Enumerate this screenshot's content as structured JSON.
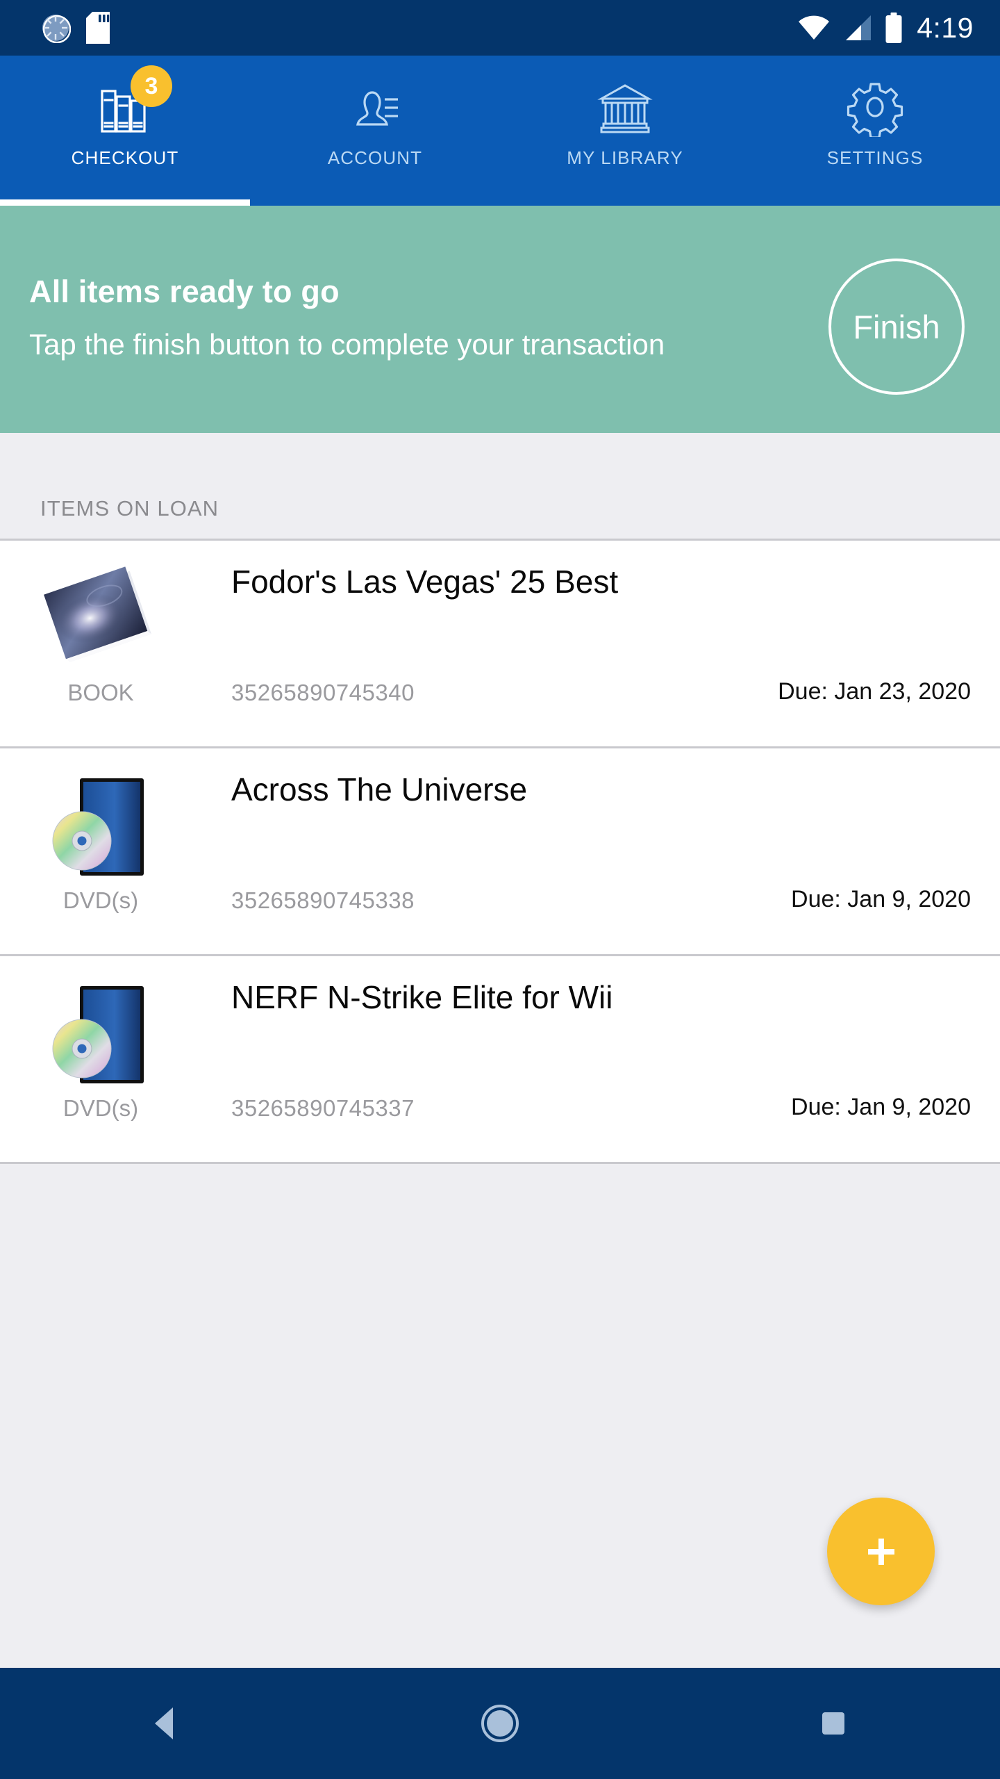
{
  "statusbar": {
    "time": "4:19",
    "icons": [
      "sync-icon",
      "sd-card-icon",
      "wifi-icon",
      "signal-icon",
      "battery-icon"
    ]
  },
  "tabs": [
    {
      "label": "CHECKOUT",
      "icon": "books-icon",
      "badge": "3",
      "active": true
    },
    {
      "label": "ACCOUNT",
      "icon": "person-icon",
      "badge": "",
      "active": false
    },
    {
      "label": "MY LIBRARY",
      "icon": "building-icon",
      "badge": "",
      "active": false
    },
    {
      "label": "SETTINGS",
      "icon": "gear-icon",
      "badge": "",
      "active": false
    }
  ],
  "banner": {
    "title": "All items ready to go",
    "subtitle": "Tap the finish button to complete your transaction",
    "finish_label": "Finish",
    "color": "#7FBFAE"
  },
  "section": {
    "header": "ITEMS ON LOAN"
  },
  "items": [
    {
      "title": "Fodor's Las Vegas' 25 Best",
      "type": "BOOK",
      "barcode": "35265890745340",
      "due": "Due: Jan 23, 2020",
      "thumb": "book-thumbnail"
    },
    {
      "title": "Across The Universe",
      "type": "DVD(s)",
      "barcode": "35265890745338",
      "due": "Due: Jan 9, 2020",
      "thumb": "dvd-thumbnail"
    },
    {
      "title": "NERF N-Strike Elite for Wii",
      "type": "DVD(s)",
      "barcode": "35265890745337",
      "due": "Due: Jan 9, 2020",
      "thumb": "dvd-thumbnail"
    }
  ],
  "fab": {
    "icon": "plus-icon",
    "color": "#F9C02E"
  },
  "navbar": {
    "back": "back-icon",
    "home": "home-icon",
    "recents": "recents-icon"
  },
  "theme": {
    "status_bar": "#04356B",
    "tab_bar": "#0B5BB5",
    "accent": "#F9C02E",
    "page_bg": "#EEEEF2"
  }
}
